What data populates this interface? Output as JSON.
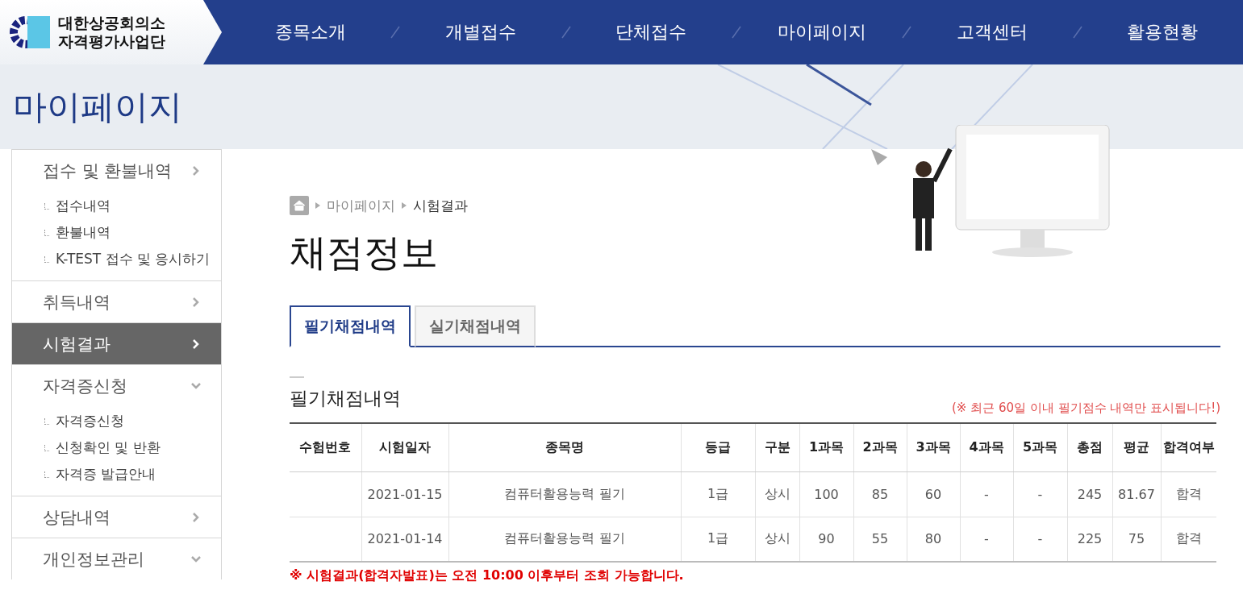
{
  "logo": {
    "line1": "대한상공회의소",
    "line2": "자격평가사업단"
  },
  "nav": [
    "종목소개",
    "개별접수",
    "단체접수",
    "마이페이지",
    "고객센터",
    "활용현황"
  ],
  "banner": {
    "title": "마이페이지"
  },
  "sidebar": [
    {
      "label": "접수 및 환불내역",
      "selected": false,
      "expanded": false,
      "children": [
        {
          "label": "접수내역"
        },
        {
          "label": "환불내역"
        },
        {
          "label": "K-TEST 접수 및 응시하기"
        }
      ]
    },
    {
      "label": "취득내역",
      "selected": false,
      "expanded": false
    },
    {
      "label": "시험결과",
      "selected": true,
      "expanded": false
    },
    {
      "label": "자격증신청",
      "selected": false,
      "expanded": true,
      "children": [
        {
          "label": "자격증신청"
        },
        {
          "label": "신청확인 및 반환"
        },
        {
          "label": "자격증 발급안내"
        }
      ]
    },
    {
      "label": "상담내역",
      "selected": false,
      "expanded": false
    },
    {
      "label": "개인정보관리",
      "selected": false,
      "expanded": true
    }
  ],
  "breadcrumb": [
    "마이페이지",
    "시험결과"
  ],
  "page_title": "채점정보",
  "tabs": [
    {
      "label": "필기채점내역",
      "selected": true
    },
    {
      "label": "실기채점내역",
      "selected": false
    }
  ],
  "section": {
    "title": "필기채점내역",
    "notice": "(※ 최근 60일 이내 필기점수 내역만 표시됩니다!)"
  },
  "table": {
    "columns": [
      "수험번호",
      "시험일자",
      "종목명",
      "등급",
      "구분",
      "1과목",
      "2과목",
      "3과목",
      "4과목",
      "5과목",
      "총점",
      "평균",
      "합격여부"
    ],
    "rows": [
      {
        "cells": [
          "",
          "2021-01-15",
          "컴퓨터활용능력 필기",
          "1급",
          "상시",
          "100",
          "85",
          "60",
          "-",
          "-",
          "245",
          "81.67",
          "합격"
        ]
      },
      {
        "cells": [
          "",
          "2021-01-14",
          "컴퓨터활용능력 필기",
          "1급",
          "상시",
          "90",
          "55",
          "80",
          "-",
          "-",
          "225",
          "75",
          "합격"
        ]
      }
    ]
  },
  "footer_note": "※ 시험결과(합격자발표)는 오전 10:00 이후부터 조회 가능합니다."
}
